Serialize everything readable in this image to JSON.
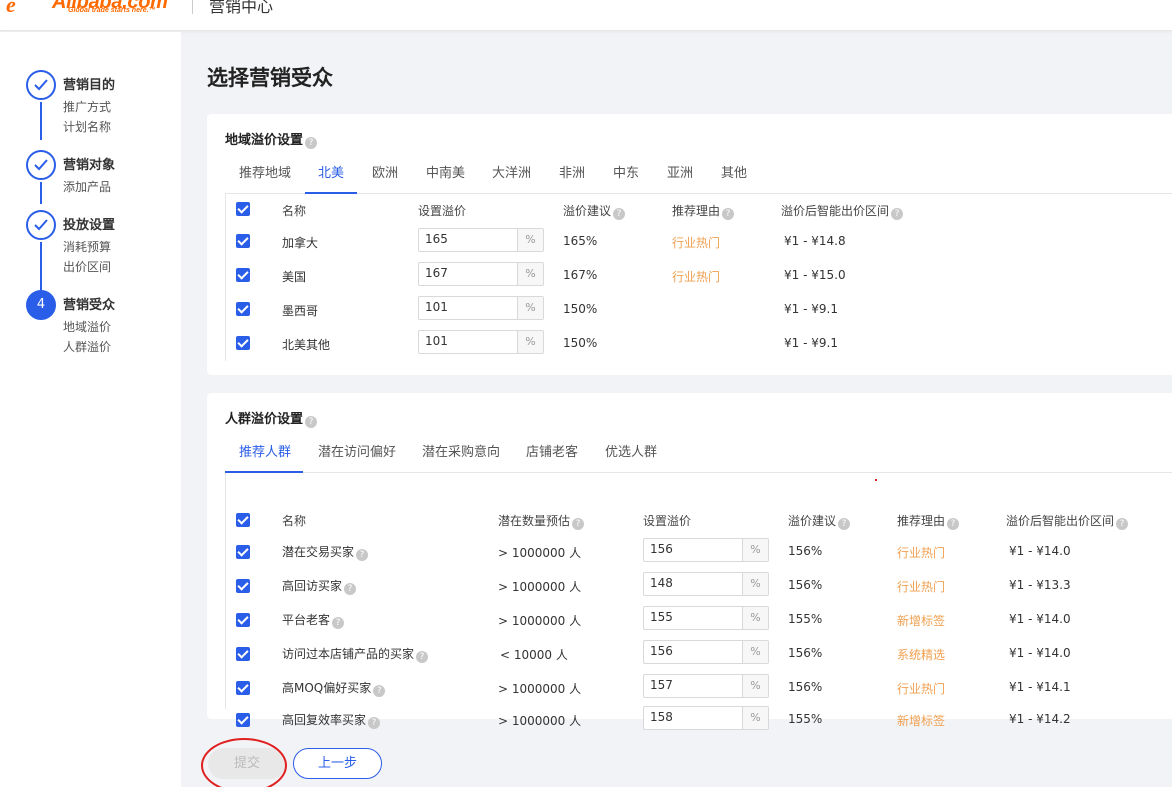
{
  "header": {
    "logo_text": "Alibaba.com",
    "logo_tagline": "Global trade starts here.™",
    "title": "营销中心"
  },
  "sidebar": {
    "steps": [
      {
        "title": "营销目的",
        "subs": [
          "推广方式",
          "计划名称"
        ],
        "state": "done"
      },
      {
        "title": "营销对象",
        "subs": [
          "添加产品"
        ],
        "state": "done"
      },
      {
        "title": "投放设置",
        "subs": [
          "消耗预算",
          "出价区间"
        ],
        "state": "done"
      },
      {
        "title": "营销受众",
        "subs": [
          "地域溢价",
          "人群溢价"
        ],
        "state": "active",
        "number": "4"
      }
    ]
  },
  "page_title": "选择营销受众",
  "region": {
    "title": "地域溢价设置",
    "tabs": [
      "推荐地域",
      "北美",
      "欧洲",
      "中南美",
      "大洋洲",
      "非洲",
      "中东",
      "亚洲",
      "其他"
    ],
    "active_tab": "北美",
    "headers": {
      "name": "名称",
      "premium": "设置溢价",
      "suggest": "溢价建议",
      "reason": "推荐理由",
      "range": "溢价后智能出价区间"
    },
    "unit": "%",
    "rows": [
      {
        "name": "加拿大",
        "value": "165",
        "suggest": "165%",
        "reason": "行业热门",
        "range": "¥1 - ¥14.8"
      },
      {
        "name": "美国",
        "value": "167",
        "suggest": "167%",
        "reason": "行业热门",
        "range": "¥1 - ¥15.0"
      },
      {
        "name": "墨西哥",
        "value": "101",
        "suggest": "150%",
        "reason": "",
        "range": "¥1 - ¥9.1"
      },
      {
        "name": "北美其他",
        "value": "101",
        "suggest": "150%",
        "reason": "",
        "range": "¥1 - ¥9.1"
      }
    ]
  },
  "crowd": {
    "title": "人群溢价设置",
    "tabs": [
      "推荐人群",
      "潜在访问偏好",
      "潜在采购意向",
      "店铺老客",
      "优选人群"
    ],
    "active_tab": "推荐人群",
    "headers": {
      "name": "名称",
      "estimate": "潜在数量预估",
      "premium": "设置溢价",
      "suggest": "溢价建议",
      "reason": "推荐理由",
      "range": "溢价后智能出价区间"
    },
    "unit": "%",
    "rows": [
      {
        "name": "潜在交易买家",
        "estimate": "> 1000000 人",
        "value": "156",
        "suggest": "156%",
        "reason": "行业热门",
        "range": "¥1 - ¥14.0"
      },
      {
        "name": "高回访买家",
        "estimate": "> 1000000 人",
        "value": "148",
        "suggest": "156%",
        "reason": "行业热门",
        "range": "¥1 - ¥13.3"
      },
      {
        "name": "平台老客",
        "estimate": "> 1000000 人",
        "value": "155",
        "suggest": "155%",
        "reason": "新增标签",
        "range": "¥1 - ¥14.0"
      },
      {
        "name": "访问过本店铺产品的买家",
        "estimate": "< 10000 人",
        "value": "156",
        "suggest": "156%",
        "reason": "系统精选",
        "range": "¥1 - ¥14.0"
      },
      {
        "name": "高MOQ偏好买家",
        "estimate": "> 1000000 人",
        "value": "157",
        "suggest": "156%",
        "reason": "行业热门",
        "range": "¥1 - ¥14.1"
      },
      {
        "name": "高回复效率买家",
        "estimate": "> 1000000 人",
        "value": "158",
        "suggest": "155%",
        "reason": "新增标签",
        "range": "¥1 - ¥14.2"
      }
    ]
  },
  "buttons": {
    "submit": "提交",
    "prev": "上一步"
  },
  "colors": {
    "primary": "#2b5ee8",
    "tag": "#f0a050",
    "annotation": "#e02020"
  }
}
